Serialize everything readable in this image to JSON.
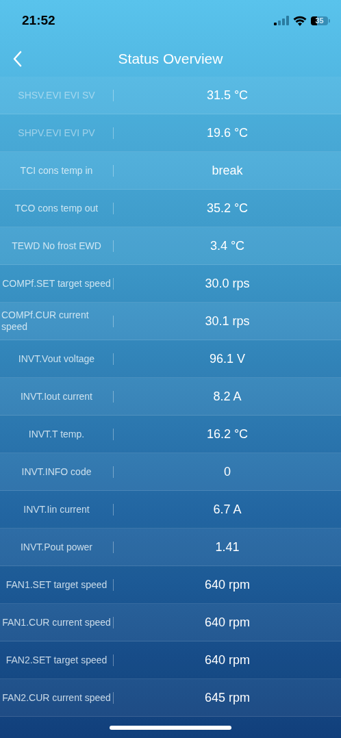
{
  "status_bar": {
    "time": "21:52",
    "battery": "35"
  },
  "nav": {
    "title": "Status Overview"
  },
  "rows": [
    {
      "label": "SHSV.EVI EVI SV",
      "value": "31.5 °C"
    },
    {
      "label": "SHPV.EVI EVI PV",
      "value": "19.6 °C"
    },
    {
      "label": "TCI cons temp in",
      "value": "break"
    },
    {
      "label": "TCO cons temp out",
      "value": "35.2 °C"
    },
    {
      "label": "TEWD No frost EWD",
      "value": "3.4 °C"
    },
    {
      "label": "COMPf.SET target speed",
      "value": "30.0 rps"
    },
    {
      "label": "COMPf.CUR current speed",
      "value": "30.1 rps"
    },
    {
      "label": "INVT.Vout voltage",
      "value": "96.1 V"
    },
    {
      "label": "INVT.Iout current",
      "value": "8.2 A"
    },
    {
      "label": "INVT.T temp.",
      "value": "16.2 °C"
    },
    {
      "label": "INVT.INFO code",
      "value": "0"
    },
    {
      "label": "INVT.Iin current",
      "value": "6.7 A"
    },
    {
      "label": "INVT.Pout power",
      "value": "1.41"
    },
    {
      "label": "FAN1.SET target speed",
      "value": "640 rpm"
    },
    {
      "label": "FAN1.CUR current speed",
      "value": "640 rpm"
    },
    {
      "label": "FAN2.SET target speed",
      "value": "640 rpm"
    },
    {
      "label": "FAN2.CUR current speed",
      "value": "645 rpm"
    }
  ]
}
